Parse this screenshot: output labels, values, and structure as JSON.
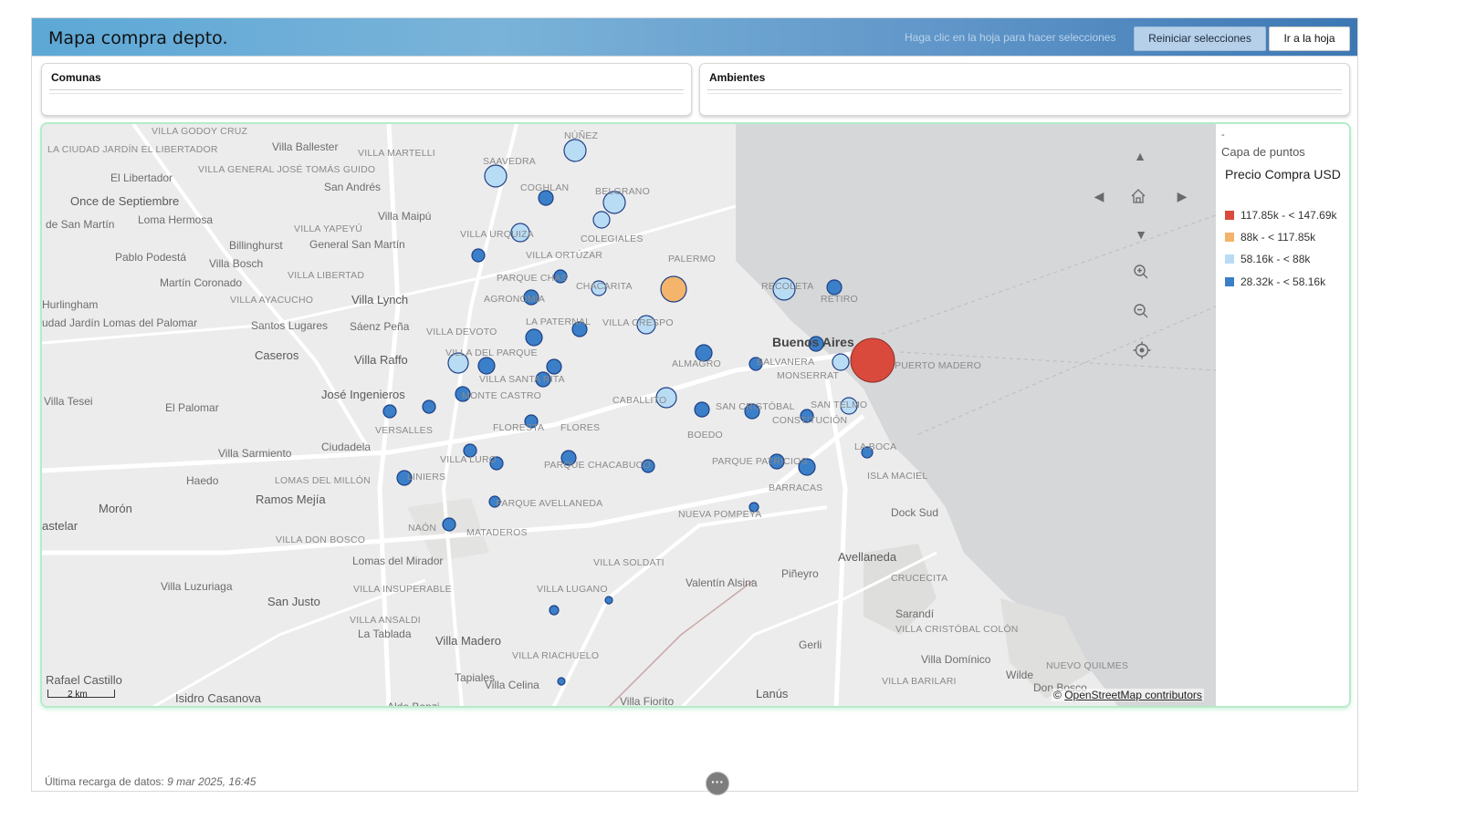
{
  "header": {
    "title": "Mapa compra depto.",
    "hint": "Haga clic en la hoja para hacer selecciones",
    "reset_button": "Reiniciar selecciones",
    "go_sheet_button": "Ir a la hoja",
    "gradient_start": "#5da8d6",
    "gradient_end": "#3d78b4"
  },
  "filters": {
    "comunas": "Comunas",
    "ambientes": "Ambientes"
  },
  "map": {
    "scale_label": "2 km",
    "attribution_prefix": "© ",
    "attribution_link": "OpenStreetMap contributors",
    "controls": [
      "pan-up-icon",
      "pan-left-icon",
      "home-icon",
      "pan-right-icon",
      "pan-down-icon",
      "zoom-in-icon",
      "zoom-out-icon",
      "locate-icon"
    ],
    "places": [
      {
        "name": "VILLA GODOY CRUZ",
        "size": "sm"
      },
      {
        "name": "Villa Ballester",
        "size": "md"
      },
      {
        "name": "LA CIUDAD JARDÍN EL LIBERTADOR",
        "size": "sm"
      },
      {
        "name": "VILLA MARTELLI",
        "size": "sm"
      },
      {
        "name": "NÚÑEZ",
        "size": "sm"
      },
      {
        "name": "El Libertador",
        "size": "md"
      },
      {
        "name": "VILLA GENERAL JOSÉ TOMÁS GUIDO",
        "size": "sm"
      },
      {
        "name": "SAAVEDRA",
        "size": "sm"
      },
      {
        "name": "San Andrés",
        "size": "md"
      },
      {
        "name": "COGHLAN",
        "size": "sm"
      },
      {
        "name": "BELGRANO",
        "size": "sm"
      },
      {
        "name": "Once de Septiembre",
        "size": "lg"
      },
      {
        "name": "Villa Maipú",
        "size": "md"
      },
      {
        "name": "Loma Hermosa",
        "size": "md"
      },
      {
        "name": "de San Martín",
        "size": "md"
      },
      {
        "name": "VILLA YAPEYÚ",
        "size": "sm"
      },
      {
        "name": "VILLA URQUIZA",
        "size": "sm"
      },
      {
        "name": "COLEGIALES",
        "size": "sm"
      },
      {
        "name": "Billinghurst",
        "size": "md"
      },
      {
        "name": "General San Martín",
        "size": "md"
      },
      {
        "name": "Pablo Podestá",
        "size": "md"
      },
      {
        "name": "VILLA ORTÚZAR",
        "size": "sm"
      },
      {
        "name": "Villa Bosch",
        "size": "md"
      },
      {
        "name": "PALERMO",
        "size": "sm"
      },
      {
        "name": "VILLA LIBERTAD",
        "size": "sm"
      },
      {
        "name": "PARQUE CHAS",
        "size": "sm"
      },
      {
        "name": "Martín Coronado",
        "size": "md"
      },
      {
        "name": "CHACARITA",
        "size": "sm"
      },
      {
        "name": "RECOLETA",
        "size": "sm"
      },
      {
        "name": "Hurlingham",
        "size": "md"
      },
      {
        "name": "VILLA AYACUCHO",
        "size": "sm"
      },
      {
        "name": "Villa Lynch",
        "size": "lg"
      },
      {
        "name": "AGRONOMÍA",
        "size": "sm"
      },
      {
        "name": "RETIRO",
        "size": "sm"
      },
      {
        "name": "udad Jardín Lomas del Palomar",
        "size": "md"
      },
      {
        "name": "LA PATERNAL",
        "size": "sm"
      },
      {
        "name": "Santos Lugares",
        "size": "md"
      },
      {
        "name": "Sáenz Peña",
        "size": "md"
      },
      {
        "name": "VILLA CRESPO",
        "size": "sm"
      },
      {
        "name": "VILLA DEVOTO",
        "size": "sm"
      },
      {
        "name": "Buenos Aires",
        "size": "xl"
      },
      {
        "name": "Caseros",
        "size": "lg"
      },
      {
        "name": "VILLA DEL PARQUE",
        "size": "sm"
      },
      {
        "name": "Villa Raffo",
        "size": "lg"
      },
      {
        "name": "ALMAGRO",
        "size": "sm"
      },
      {
        "name": "BALVANERA",
        "size": "sm"
      },
      {
        "name": "PUERTO MADERO",
        "size": "sm"
      },
      {
        "name": "VILLA SANTA RITA",
        "size": "sm"
      },
      {
        "name": "MONSERRAT",
        "size": "sm"
      },
      {
        "name": "José Ingenieros",
        "size": "lg"
      },
      {
        "name": "MONTE CASTRO",
        "size": "sm"
      },
      {
        "name": "CABALLITO",
        "size": "sm"
      },
      {
        "name": "Villa Tesei",
        "size": "md"
      },
      {
        "name": "El Palomar",
        "size": "md"
      },
      {
        "name": "SAN CRISTÓBAL",
        "size": "sm"
      },
      {
        "name": "SAN TELMO",
        "size": "sm"
      },
      {
        "name": "CONSTITUCIÓN",
        "size": "sm"
      },
      {
        "name": "VERSALLES",
        "size": "sm"
      },
      {
        "name": "FLORESTA",
        "size": "sm"
      },
      {
        "name": "FLORES",
        "size": "sm"
      },
      {
        "name": "BOEDO",
        "size": "sm"
      },
      {
        "name": "LA BOCA",
        "size": "sm"
      },
      {
        "name": "Ciudadela",
        "size": "md"
      },
      {
        "name": "Villa Sarmiento",
        "size": "md"
      },
      {
        "name": "VILLA LURO",
        "size": "sm"
      },
      {
        "name": "PARQUE CHACABUCO",
        "size": "sm"
      },
      {
        "name": "PARQUE PATRICIOS",
        "size": "sm"
      },
      {
        "name": "Haedo",
        "size": "md"
      },
      {
        "name": "LOMAS DEL MILLÓN",
        "size": "sm"
      },
      {
        "name": "LINIERS",
        "size": "sm"
      },
      {
        "name": "ISLA MACIEL",
        "size": "sm"
      },
      {
        "name": "Ramos Mejía",
        "size": "lg"
      },
      {
        "name": "BARRACAS",
        "size": "sm"
      },
      {
        "name": "Morón",
        "size": "lg"
      },
      {
        "name": "PARQUE AVELLANEDA",
        "size": "sm"
      },
      {
        "name": "NUEVA POMPEYA",
        "size": "sm"
      },
      {
        "name": "Dock Sud",
        "size": "md"
      },
      {
        "name": "astelar",
        "size": "lg"
      },
      {
        "name": "NAÓN",
        "size": "sm"
      },
      {
        "name": "MATADEROS",
        "size": "sm"
      },
      {
        "name": "VILLA DON BOSCO",
        "size": "sm"
      },
      {
        "name": "Lomas del Mirador",
        "size": "md"
      },
      {
        "name": "Avellaneda",
        "size": "lg"
      },
      {
        "name": "VILLA SOLDATI",
        "size": "sm"
      },
      {
        "name": "Piñeyro",
        "size": "md"
      },
      {
        "name": "CRUCECITA",
        "size": "sm"
      },
      {
        "name": "Villa Luzuriaga",
        "size": "md"
      },
      {
        "name": "Valentín Alsina",
        "size": "md"
      },
      {
        "name": "VILLA INSUPERABLE",
        "size": "sm"
      },
      {
        "name": "VILLA LUGANO",
        "size": "sm"
      },
      {
        "name": "San Justo",
        "size": "lg"
      },
      {
        "name": "Sarandí",
        "size": "md"
      },
      {
        "name": "VILLA ANSALDI",
        "size": "sm"
      },
      {
        "name": "VILLA CRISTÓBAL COLÓN",
        "size": "sm"
      },
      {
        "name": "La Tablada",
        "size": "md"
      },
      {
        "name": "Villa Madero",
        "size": "lg"
      },
      {
        "name": "Gerli",
        "size": "md"
      },
      {
        "name": "VILLA RIACHUELO",
        "size": "sm"
      },
      {
        "name": "Villa Domínico",
        "size": "md"
      },
      {
        "name": "NUEVO QUILMES",
        "size": "sm"
      },
      {
        "name": "Rafael Castillo",
        "size": "lg"
      },
      {
        "name": "Tapiales",
        "size": "md"
      },
      {
        "name": "Wilde",
        "size": "md"
      },
      {
        "name": "VILLA BARILARI",
        "size": "sm"
      },
      {
        "name": "Villa Celina",
        "size": "md"
      },
      {
        "name": "Don Bosco",
        "size": "md"
      },
      {
        "name": "Isidro Casanova",
        "size": "lg"
      },
      {
        "name": "Lanús",
        "size": "lg"
      },
      {
        "name": "Villa Fiorito",
        "size": "md"
      },
      {
        "name": "Aldo Bonzi",
        "size": "md"
      }
    ]
  },
  "legend": {
    "dash": "-",
    "layer": "Capa de puntos",
    "title": "Precio Compra USD",
    "items": [
      {
        "label": "117.85k - < 147.69k",
        "color": "#d94a3d"
      },
      {
        "label": "88k - < 117.85k",
        "color": "#f4b46b"
      },
      {
        "label": "58.16k - < 88k",
        "color": "#b9dcf5"
      },
      {
        "label": "28.32k - < 58.16k",
        "color": "#3a7fc8"
      }
    ]
  },
  "footer": {
    "label": "Última recarga de datos: ",
    "value": "9 mar 2025, 16:45",
    "more_icon": "···"
  }
}
